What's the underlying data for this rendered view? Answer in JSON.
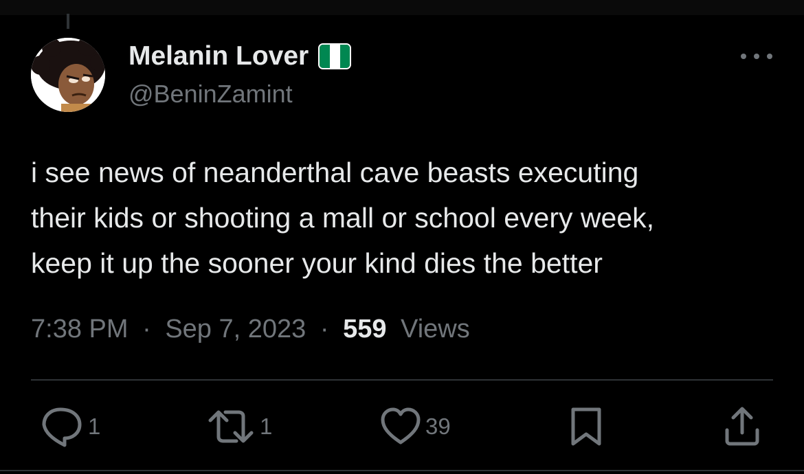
{
  "tweet": {
    "display_name": "Melanin Lover",
    "handle": "@BeninZamint",
    "text_lines": [
      "i see news of neanderthal cave beasts executing",
      "their kids or shooting a mall or school every week,",
      "keep it up the sooner your kind dies the better"
    ],
    "time": "7:38 PM",
    "separator": "·",
    "date": "Sep 7, 2023",
    "views_count": "559",
    "views_label": "Views"
  },
  "actions": {
    "reply_count": "1",
    "retweet_count": "1",
    "like_count": "39"
  },
  "icons": {
    "reply": "reply-icon",
    "retweet": "retweet-icon",
    "like": "heart-icon",
    "bookmark": "bookmark-icon",
    "share": "share-icon",
    "more": "more-icon",
    "flag": "nigeria-flag-icon"
  },
  "colors": {
    "background": "#000000",
    "text": "#e7e9ea",
    "secondary": "#71767b",
    "flag_green": "#008751",
    "flag_white": "#ffffff"
  }
}
